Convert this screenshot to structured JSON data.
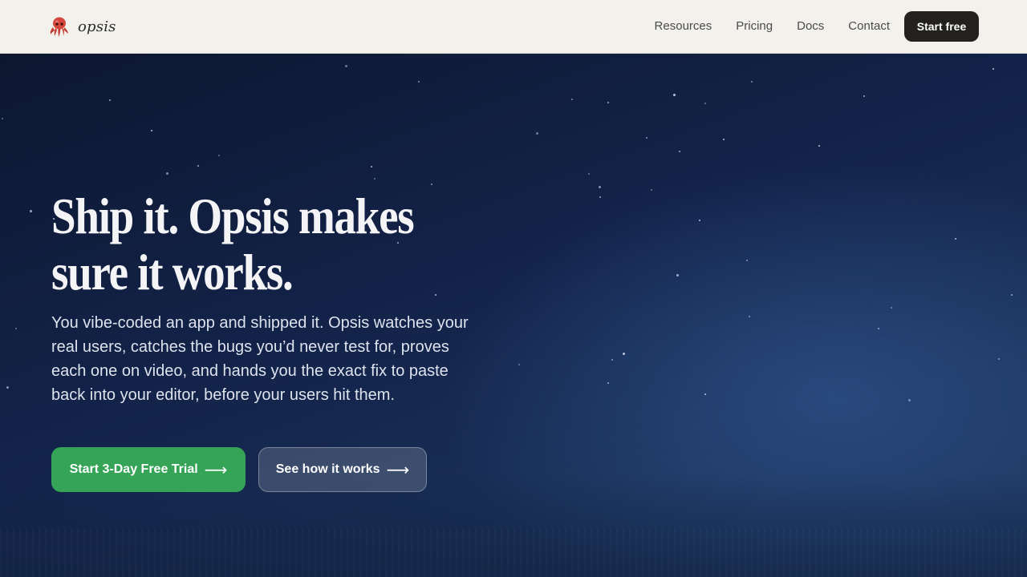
{
  "nav": {
    "brand_name": "opsis",
    "brand_icon": "octopus-icon",
    "links": [
      "Resources",
      "Pricing",
      "Docs",
      "Contact"
    ],
    "cta_label": "Start free"
  },
  "hero": {
    "headline_line1": "Ship it. Opsis makes",
    "headline_line2": "sure it works.",
    "subcopy": "You vibe-coded an app and shipped it. Opsis watches your real users, catches the bugs you’d never test for, proves each one on video, and hands you the exact fix to paste back into your editor, before your users hit them.",
    "primary_cta": "Start 3-Day Free Trial",
    "secondary_cta": "See how it works",
    "arrow_icon": "arrow-right-icon"
  },
  "colors": {
    "nav_bg": "#f3f1ec",
    "cta_dark": "#23211d",
    "primary_green": "#35a457",
    "hero_navy": "#13234a"
  }
}
